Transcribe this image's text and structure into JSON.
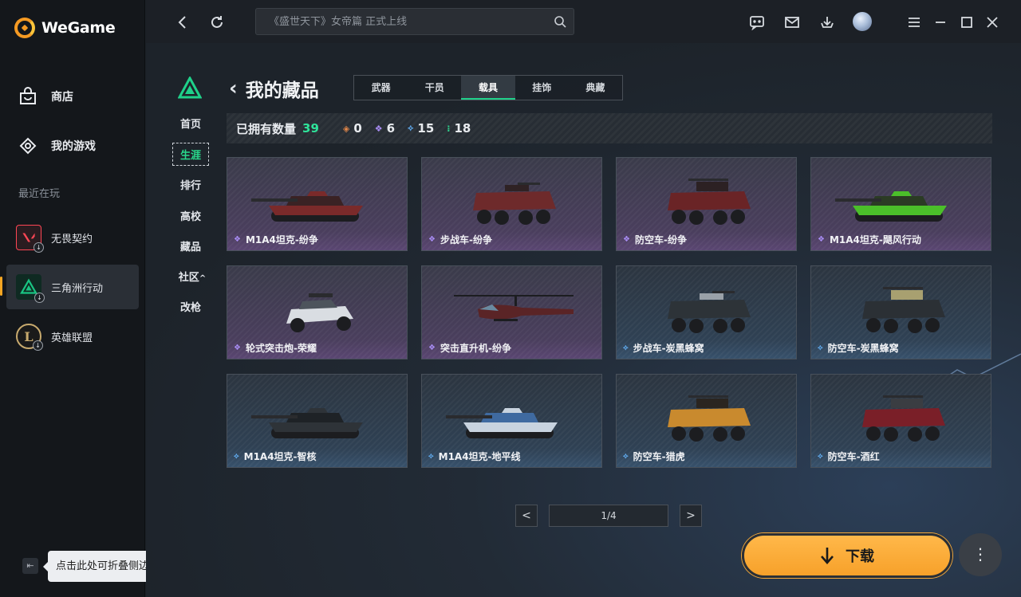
{
  "app": {
    "name": "WeGame"
  },
  "sidebar": {
    "nav": [
      {
        "label": "商店",
        "icon": "shop-bag-icon"
      },
      {
        "label": "我的游戏",
        "icon": "gamepad-icon"
      }
    ],
    "recent_label": "最近在玩",
    "games": [
      {
        "name": "无畏契约",
        "icon": "valorant-icon",
        "color": "#ff4655"
      },
      {
        "name": "三角洲行动",
        "icon": "delta-force-icon",
        "color": "#19c482",
        "active": true
      },
      {
        "name": "英雄联盟",
        "icon": "league-of-legends-icon",
        "color": "#c8aa6e"
      }
    ],
    "collapse_tooltip": "点击此处可折叠侧边栏"
  },
  "topbar": {
    "search_placeholder": "《盛世天下》女帝篇 正式上线"
  },
  "subnav": {
    "items": [
      "首页",
      "生涯",
      "排行",
      "高校",
      "藏品",
      "社区",
      "改枪"
    ],
    "active": "生涯",
    "community_arrow": "^"
  },
  "page": {
    "title": "我的藏品",
    "tabs": [
      "武器",
      "干员",
      "载具",
      "挂饰",
      "典藏"
    ],
    "active_tab": "载具"
  },
  "owned": {
    "label": "已拥有数量",
    "total": "39",
    "rarities": [
      {
        "icon": "orange-diamond-icon",
        "color": "#e0864a",
        "count": "0"
      },
      {
        "icon": "purple-diamond-icon",
        "color": "#a98df5",
        "count": "6"
      },
      {
        "icon": "blue-diamond-icon",
        "color": "#5fa8ea",
        "count": "15"
      },
      {
        "icon": "green-diamond-icon",
        "color": "#2fd38e",
        "count": "18"
      }
    ]
  },
  "items": [
    {
      "name": "M1A4坦克-纷争",
      "type": "tank",
      "rarity": "epic"
    },
    {
      "name": "步战车-纷争",
      "type": "apc",
      "rarity": "epic"
    },
    {
      "name": "防空车-纷争",
      "type": "aa",
      "rarity": "epic"
    },
    {
      "name": "M1A4坦克-飓风行动",
      "type": "tank",
      "rarity": "epic"
    },
    {
      "name": "轮式突击炮-荣耀",
      "type": "buggy",
      "rarity": "epic"
    },
    {
      "name": "突击直升机-纷争",
      "type": "heli",
      "rarity": "epic"
    },
    {
      "name": "步战车-炭黑蜂窝",
      "type": "apc",
      "rarity": "rare"
    },
    {
      "name": "防空车-炭黑蜂窝",
      "type": "aa",
      "rarity": "rare"
    },
    {
      "name": "M1A4坦克-智核",
      "type": "tank",
      "rarity": "rare"
    },
    {
      "name": "M1A4坦克-地平线",
      "type": "tank",
      "rarity": "rare"
    },
    {
      "name": "防空车-猎虎",
      "type": "aa",
      "rarity": "rare"
    },
    {
      "name": "防空车-酒红",
      "type": "aa",
      "rarity": "rare"
    }
  ],
  "pagination": {
    "display": "1/4",
    "prev": "<",
    "next": ">"
  },
  "actions": {
    "download_label": "下载",
    "more": "⋮"
  }
}
